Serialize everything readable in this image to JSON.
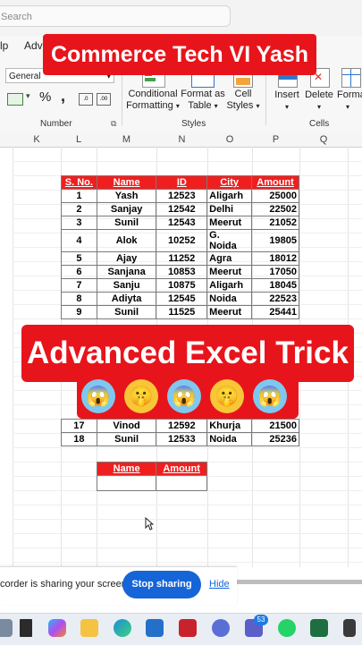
{
  "app": {
    "search_placeholder": "Search",
    "menu_partial": [
      "lp",
      "Adva"
    ]
  },
  "ribbon": {
    "number_format": "General",
    "number_group_label": "Number",
    "styles_group_label": "Styles",
    "cells_group_label": "Cells",
    "conditional_formatting": [
      "Conditional",
      "Formatting"
    ],
    "format_as_table": [
      "Format as",
      "Table"
    ],
    "cell_styles": [
      "Cell",
      "Styles"
    ],
    "insert": "Insert",
    "delete": "Delete",
    "format": "Forma",
    "percent_symbol": "%",
    "comma_symbol": ","
  },
  "overlay": {
    "top_banner": "Commerce Tech VI Yash",
    "main_banner": "Advanced Excel Trick",
    "emoji_row": [
      "😱",
      "🤫",
      "😱",
      "🤫",
      "😱"
    ]
  },
  "columns": [
    "K",
    "L",
    "M",
    "N",
    "O",
    "P",
    "Q"
  ],
  "table": {
    "headers": [
      "S. No.",
      "Name",
      "ID",
      "City",
      "Amount"
    ],
    "rows": [
      [
        "1",
        "Yash",
        "12523",
        "Aligarh",
        "25000"
      ],
      [
        "2",
        "Sanjay",
        "12542",
        "Delhi",
        "22502"
      ],
      [
        "3",
        "Sunil",
        "12543",
        "Meerut",
        "21052"
      ],
      [
        "4",
        "Alok",
        "10252",
        "G. Noida",
        "19805"
      ],
      [
        "5",
        "Ajay",
        "11252",
        "Agra",
        "18012"
      ],
      [
        "6",
        "Sanjana",
        "10853",
        "Meerut",
        "17050"
      ],
      [
        "7",
        "Sanju",
        "10875",
        "Aligarh",
        "18045"
      ],
      [
        "8",
        "Adiyta",
        "12545",
        "Noida",
        "22523"
      ],
      [
        "9",
        "Sunil",
        "11525",
        "Meerut",
        "25441"
      ]
    ],
    "bottom_rows": [
      [
        "17",
        "Vinod",
        "12592",
        "Khurja",
        "21500"
      ],
      [
        "18",
        "Sunil",
        "12533",
        "Noida",
        "25236"
      ]
    ]
  },
  "lookup": {
    "headers": [
      "Name",
      "Amount"
    ],
    "values": [
      "",
      ""
    ]
  },
  "sharing": {
    "message": "corder is sharing your screen.",
    "stop_label": "Stop sharing",
    "hide_label": "Hide"
  },
  "taskbar": {
    "badge_count": "53",
    "icons": [
      "windows-icon",
      "file-icon",
      "copilot-icon",
      "folder-icon",
      "edge-icon",
      "store-icon",
      "mcafee-icon",
      "app-icon",
      "teams-icon",
      "whatsapp-icon",
      "chrome-icon",
      "excel-icon",
      "more-icon"
    ]
  },
  "colors": {
    "accent_red": "#e8141b",
    "header_red": "#f01f1f",
    "share_blue": "#1565d8",
    "excel_green": "#1d6f42"
  }
}
